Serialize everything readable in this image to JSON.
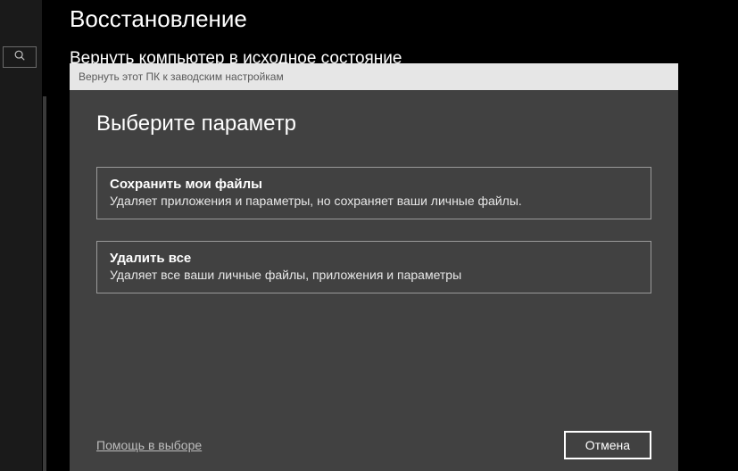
{
  "back": {
    "title": "Восстановление",
    "subtitle": "Вернуть компьютер в исходное состояние"
  },
  "dialog": {
    "titlebar": "Вернуть этот ПК к заводским настройкам",
    "heading": "Выберите параметр",
    "options": [
      {
        "title": "Сохранить мои файлы",
        "desc": "Удаляет приложения и параметры, но сохраняет ваши личные файлы."
      },
      {
        "title": "Удалить все",
        "desc": "Удаляет все ваши личные файлы, приложения и параметры"
      }
    ],
    "help_link": "Помощь в выборе",
    "cancel_label": "Отмена"
  }
}
